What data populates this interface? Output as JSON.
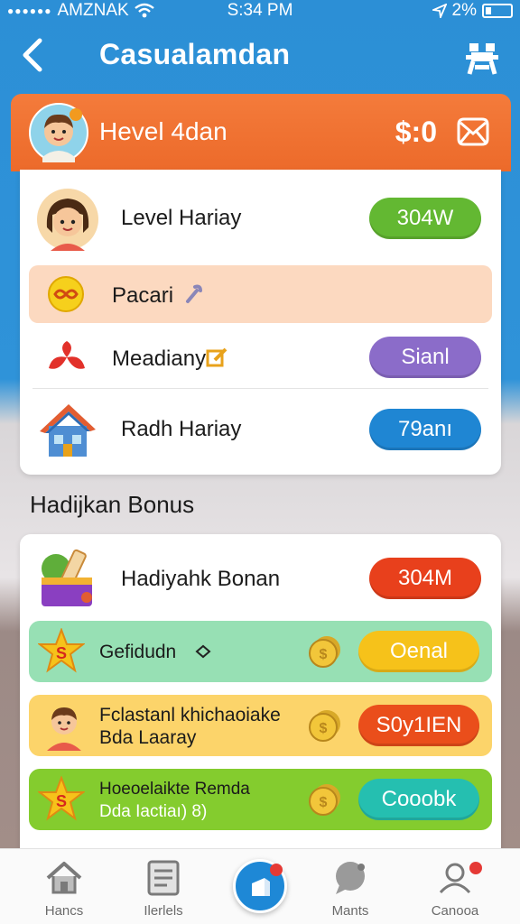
{
  "status_bar": {
    "carrier": "AMZNAK",
    "time": "S:34 PM",
    "battery": "2%"
  },
  "header": {
    "title": "Casualamdan"
  },
  "level_banner": {
    "title": "Hevel 4dan",
    "amount": "$:0"
  },
  "list": [
    {
      "label": "Level Hariay",
      "badge": "304W",
      "badge_color": "#63b832"
    },
    {
      "label": "Pacari"
    },
    {
      "label": "Meadiany",
      "badge": "Sianl",
      "badge_color": "#8b6cc9"
    },
    {
      "label": "Radh Hariay",
      "badge": "79anı",
      "badge_color": "#1f86d3"
    }
  ],
  "bonus_section": {
    "title": "Hadijkan Bonus",
    "header_item": {
      "label": "Hadiyahk Bonan",
      "badge": "304M",
      "badge_color": "#e8401c"
    },
    "items": [
      {
        "line1": "Gefidudn",
        "line2": "",
        "button": "Oenal",
        "bg": "#97e0b4",
        "button_color": "#f6c21a"
      },
      {
        "line1": "Fclastanl khichaoiake",
        "line2": "Bda Laaray",
        "button": "S0y1IEN",
        "bg": "#fcd46a",
        "button_color": "#ea4e1b"
      },
      {
        "line1": "Hoeoelaikte Remda",
        "line2": "Dda Iactiaı) 8)",
        "button": "Cooobk",
        "bg": "#84cc2e",
        "button_color": "#25bfb0"
      }
    ]
  },
  "bottom_nav": {
    "items": [
      {
        "label": "Hancs",
        "icon": "home-icon"
      },
      {
        "label": "Ilerlels",
        "icon": "list-icon"
      },
      {
        "label": "",
        "icon": "add-icon"
      },
      {
        "label": "Mants",
        "icon": "chat-icon"
      },
      {
        "label": "Canooa",
        "icon": "profile-icon"
      }
    ]
  },
  "colors": {
    "header": "#2c8fd6",
    "banner": "#f0722f"
  }
}
